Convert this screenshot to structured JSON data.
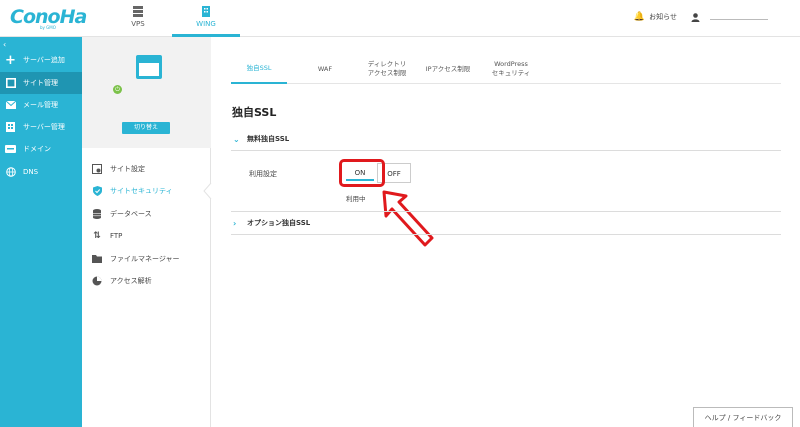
{
  "brand": {
    "logo": "ConoHa",
    "logo_sub": "by GMO"
  },
  "topnav": [
    {
      "label": "VPS",
      "icon": "server-icon",
      "active": false
    },
    {
      "label": "WING",
      "icon": "building-icon",
      "active": true
    }
  ],
  "header_right": {
    "notifications_label": "お知らせ"
  },
  "sidebar": {
    "collapse_icon": "chevron-left-icon",
    "items": [
      {
        "label": "サーバー追加",
        "icon": "plus-icon"
      },
      {
        "label": "サイト管理",
        "icon": "window-icon",
        "active": true
      },
      {
        "label": "メール管理",
        "icon": "mail-icon"
      },
      {
        "label": "サーバー管理",
        "icon": "server-icon"
      },
      {
        "label": "ドメイン",
        "icon": "domain-icon"
      },
      {
        "label": "DNS",
        "icon": "globe-icon"
      }
    ]
  },
  "site_card": {
    "switch_label": "切り替え"
  },
  "subnav": [
    {
      "label": "サイト設定",
      "icon": "settings-icon"
    },
    {
      "label": "サイトセキュリティ",
      "icon": "shield-icon",
      "active": true
    },
    {
      "label": "データベース",
      "icon": "database-icon"
    },
    {
      "label": "FTP",
      "icon": "transfer-icon"
    },
    {
      "label": "ファイルマネージャー",
      "icon": "folder-icon"
    },
    {
      "label": "アクセス解析",
      "icon": "pie-chart-icon"
    }
  ],
  "tabs": [
    {
      "label": "独自SSL",
      "active": true
    },
    {
      "label": "WAF"
    },
    {
      "label": "ディレクトリ\nアクセス制限"
    },
    {
      "label": "IPアクセス制限"
    },
    {
      "label": "WordPress\nセキュリティ"
    }
  ],
  "page_title": "独自SSL",
  "free_ssl": {
    "heading": "無料独自SSL",
    "setting_label": "利用設定",
    "on_label": "ON",
    "off_label": "OFF",
    "status": "利用中",
    "selected": "ON"
  },
  "option_ssl": {
    "heading": "オプション独自SSL"
  },
  "help_button": "ヘルプ / フィードバック",
  "colors": {
    "accent": "#2ab4d4",
    "sidebar_active": "#1f95b2",
    "highlight": "#e0191d",
    "power": "#7cc24a"
  }
}
